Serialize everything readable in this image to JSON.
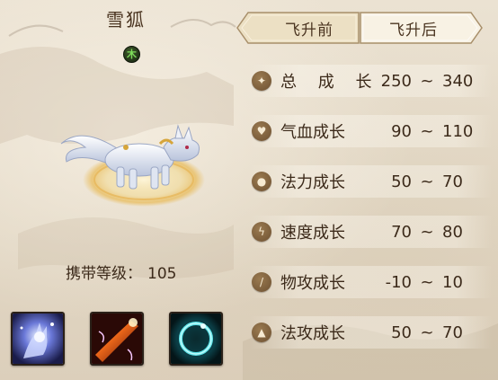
{
  "pet": {
    "name": "雪狐",
    "element": "木",
    "element_color": "#7ddc5a",
    "level_label": "携带等级：",
    "level_value": "105"
  },
  "tabs": [
    {
      "label": "飞升前",
      "active": true
    },
    {
      "label": "飞升后",
      "active": false
    }
  ],
  "stats": [
    {
      "icon": "growth-icon",
      "label": "总 成 长",
      "min": "250",
      "sep": "~",
      "max": "340"
    },
    {
      "icon": "heart-icon",
      "label": "气血成长",
      "min": "90",
      "sep": "~",
      "max": "110"
    },
    {
      "icon": "mana-drop-icon",
      "label": "法力成长",
      "min": "50",
      "sep": "~",
      "max": "70"
    },
    {
      "icon": "speed-icon",
      "label": "速度成长",
      "min": "70",
      "sep": "~",
      "max": "80"
    },
    {
      "icon": "sword-icon",
      "label": "物攻成长",
      "min": "-10",
      "sep": "~",
      "max": "10"
    },
    {
      "icon": "flame-icon",
      "label": "法攻成长",
      "min": "50",
      "sep": "~",
      "max": "70"
    }
  ],
  "skills": [
    {
      "icon": "frost-hand-skill-icon"
    },
    {
      "icon": "fire-strike-skill-icon"
    },
    {
      "icon": "water-ring-skill-icon"
    }
  ],
  "colors": {
    "text": "#3c2a1a",
    "tab_active": "#efe3c8",
    "tab_inactive": "#f7f1e4",
    "stat_icon_bg": "#7d5e3a"
  }
}
